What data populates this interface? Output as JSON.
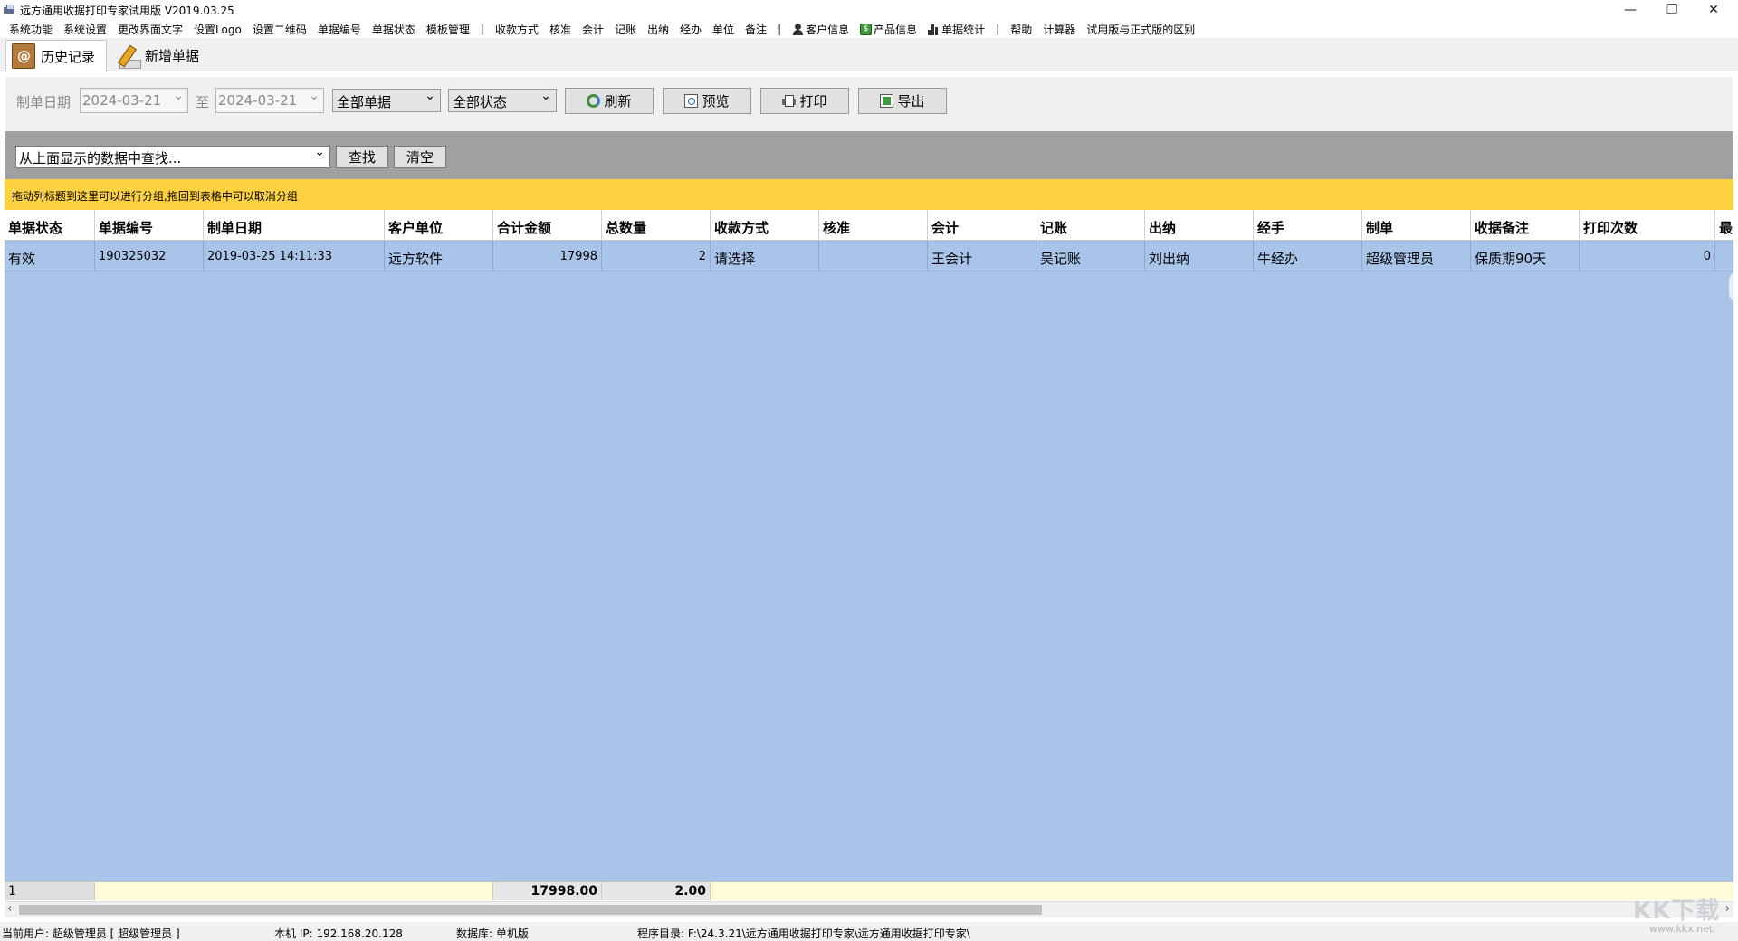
{
  "window": {
    "title": "远方通用收据打印专家试用版 V2019.03.25",
    "controls": {
      "minimize": "—",
      "maximize": "❐",
      "close": "✕"
    }
  },
  "menu": {
    "items": [
      "系统功能",
      "系统设置",
      "更改界面文字",
      "设置Logo",
      "设置二维码",
      "单据编号",
      "单据状态",
      "模板管理",
      "|",
      "收款方式",
      "核准",
      "会计",
      "记账",
      "出纳",
      "经办",
      "单位",
      "备注",
      "|",
      "客户信息",
      "产品信息",
      "单据统计",
      "|",
      "帮助",
      "计算器",
      "试用版与正式版的区别"
    ]
  },
  "tabs": [
    {
      "label": "历史记录",
      "icon": "address-book-icon",
      "active": true
    },
    {
      "label": "新增单据",
      "icon": "pencil-icon",
      "active": false
    }
  ],
  "toolbar": {
    "date_label": "制单日期",
    "date_from": "2024-03-21",
    "to_label": "至",
    "date_to": "2024-03-21",
    "doc_filter": "全部单据",
    "status_filter": "全部状态",
    "refresh_label": "刷新",
    "preview_label": "预览",
    "print_label": "打印",
    "export_label": "导出"
  },
  "search": {
    "placeholder_text": "从上面显示的数据中查找...",
    "find_label": "查找",
    "clear_label": "清空"
  },
  "group_hint": "拖动列标题到这里可以进行分组,拖回到表格中可以取消分组",
  "table": {
    "columns": [
      "单据状态",
      "单据编号",
      "制单日期",
      "客户单位",
      "合计金额",
      "总数量",
      "收款方式",
      "核准",
      "会计",
      "记账",
      "出纳",
      "经手",
      "制单",
      "收据备注",
      "打印次数",
      "最"
    ],
    "rows": [
      [
        "有效",
        "190325032",
        "2019-03-25 14:11:33",
        "远方软件",
        "17998",
        "2",
        "请选择",
        "",
        "王会计",
        "吴记账",
        "刘出纳",
        "牛经办",
        "超级管理员",
        "保质期90天",
        "0",
        ""
      ]
    ],
    "summary": {
      "count": "1",
      "total_amount": "17998.00",
      "total_quantity": "2.00"
    }
  },
  "statusbar": {
    "user": "当前用户: 超级管理员 [ 超级管理员 ]",
    "ip": "本机 IP: 192.168.20.128",
    "db": "数据库: 单机版",
    "path": "程序目录: F:\\24.3.21\\远方通用收据打印专家\\远方通用收据打印专家\\"
  },
  "watermark": {
    "logo": "KK下载",
    "url": "www.kkx.net"
  }
}
